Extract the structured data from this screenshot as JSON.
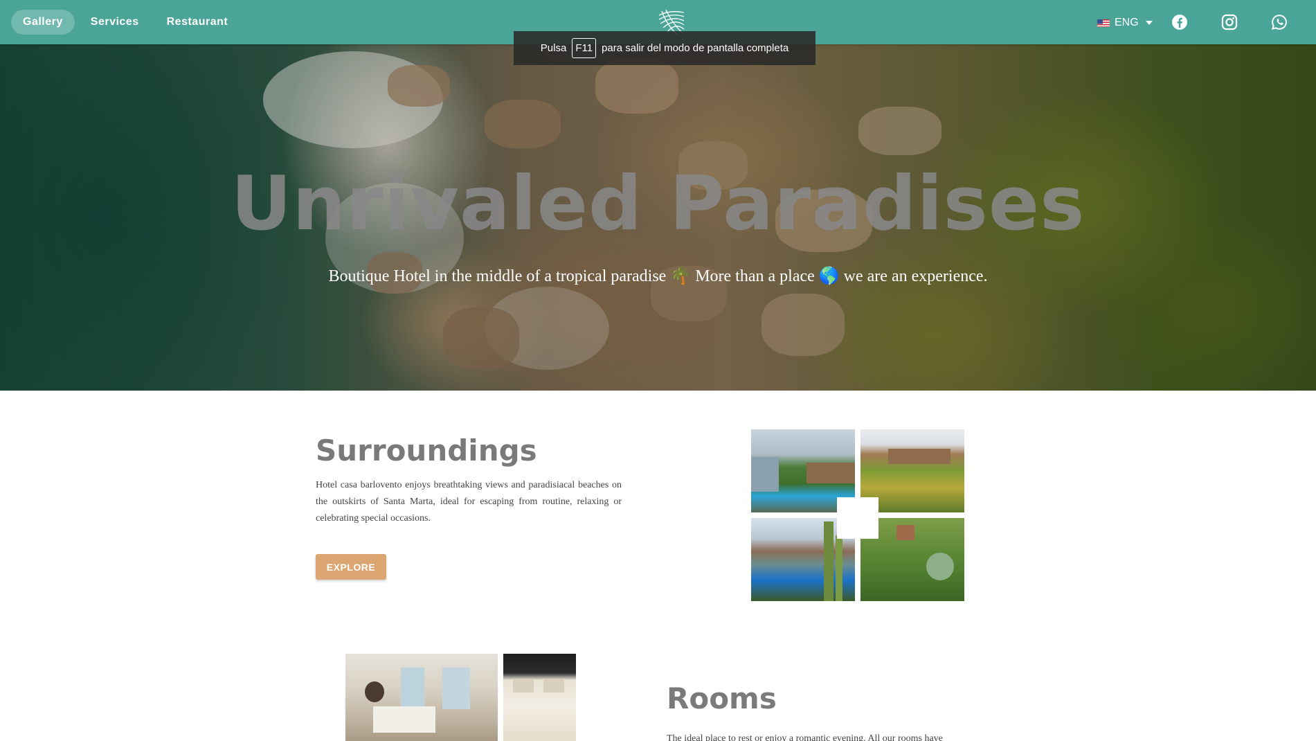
{
  "nav": {
    "links": [
      "Gallery",
      "Services",
      "Restaurant"
    ],
    "active": "Gallery",
    "language": "ENG",
    "logo_icon": "palm-leaf-icon",
    "social_icons": [
      "facebook-icon",
      "instagram-icon",
      "whatsapp-icon"
    ],
    "color": "#4aa498"
  },
  "toast": {
    "prefix": "Pulsa",
    "key": "F11",
    "suffix": "para salir del modo de pantalla completa"
  },
  "hero": {
    "title": "Unrivaled Paradises",
    "subtitle": "Boutique Hotel in the middle of a tropical paradise 🌴 More than a place 🌎 we are an experience."
  },
  "surroundings": {
    "title": "Surroundings",
    "text": "Hotel casa barlovento enjoys breathtaking views and paradisiacal beaches on the outskirts of Santa Marta, ideal for escaping from routine, relaxing or celebrating special occasions.",
    "button": "EXPLORE",
    "button_color": "#dba572"
  },
  "rooms": {
    "title": "Rooms",
    "text": "The ideal place to rest or enjoy a romantic evening. All our rooms have"
  }
}
